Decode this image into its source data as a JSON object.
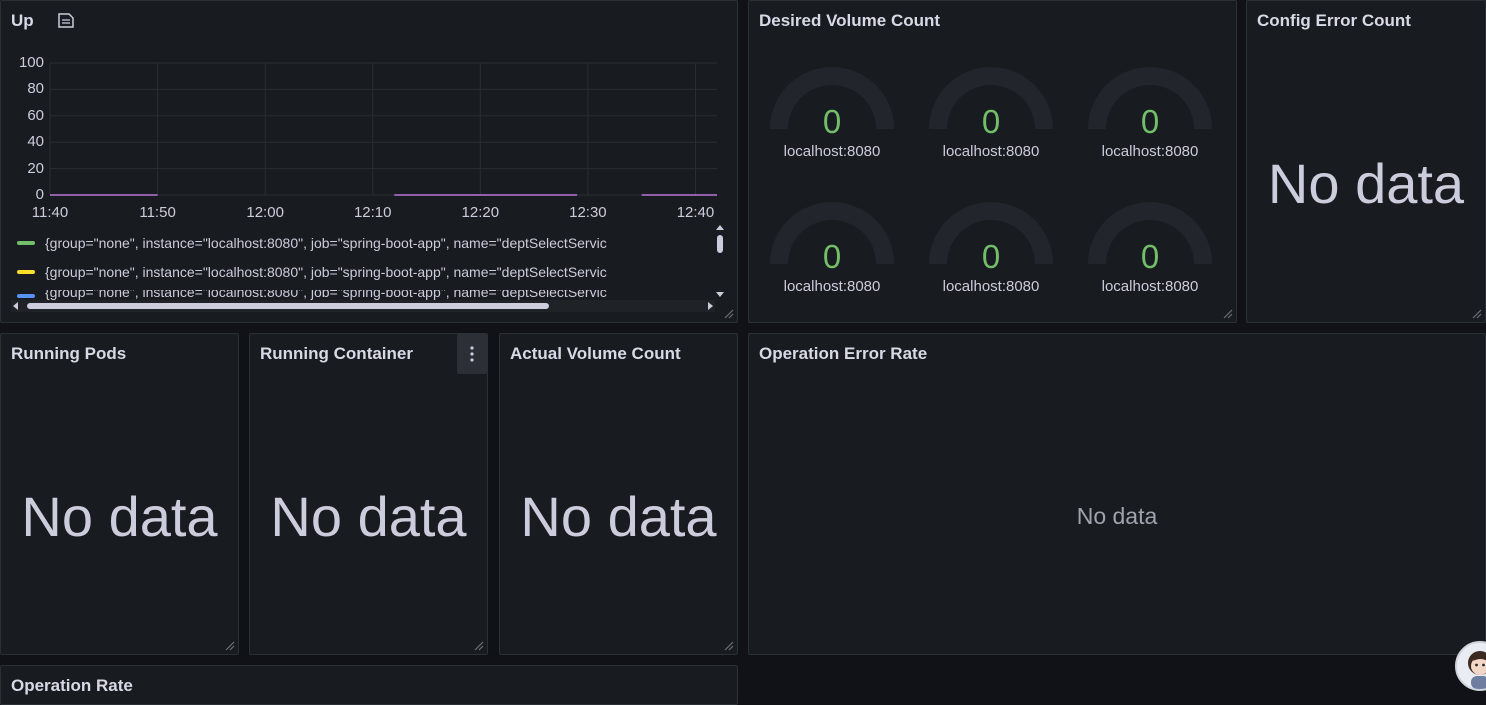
{
  "panels": {
    "up": {
      "title": "Up",
      "legend": [
        {
          "label": "{group=\"none\", instance=\"localhost:8080\", job=\"spring-boot-app\", name=\"deptSelectServic",
          "color": "#73bf69"
        },
        {
          "label": "{group=\"none\", instance=\"localhost:8080\", job=\"spring-boot-app\", name=\"deptSelectServic",
          "color": "#fade2a"
        },
        {
          "label": "{group=\"none\", instance=\"localhost:8080\", job=\"spring-boot-app\", name=\"deptSelectServic",
          "color": "#5794f2"
        }
      ]
    },
    "desired_volume": {
      "title": "Desired Volume Count",
      "gauges": [
        {
          "value": "0",
          "label": "localhost:8080"
        },
        {
          "value": "0",
          "label": "localhost:8080"
        },
        {
          "value": "0",
          "label": "localhost:8080"
        },
        {
          "value": "0",
          "label": "localhost:8080"
        },
        {
          "value": "0",
          "label": "localhost:8080"
        },
        {
          "value": "0",
          "label": "localhost:8080"
        }
      ],
      "value_color": "#73bf69"
    },
    "config_error": {
      "title": "Config Error Count",
      "message": "No data"
    },
    "running_pods": {
      "title": "Running Pods",
      "message": "No data"
    },
    "running_container": {
      "title": "Running Container",
      "message": "No data"
    },
    "actual_volume": {
      "title": "Actual Volume Count",
      "message": "No data"
    },
    "operation_error_rate": {
      "title": "Operation Error Rate",
      "message": "No data"
    },
    "operation_rate": {
      "title": "Operation Rate"
    }
  },
  "chart_data": {
    "type": "line",
    "x": [
      "11:40",
      "11:50",
      "12:00",
      "12:10",
      "12:20",
      "12:30",
      "12:40"
    ],
    "yticks": [
      0,
      20,
      40,
      60,
      80,
      100
    ],
    "ylim": [
      0,
      100
    ],
    "xlim_minutes": [
      0,
      62
    ],
    "grid": true,
    "series": [
      {
        "color": "#b877d9",
        "segments": [
          [
            0,
            10
          ],
          [
            32,
            49
          ],
          [
            55,
            62
          ]
        ],
        "value": 0
      }
    ]
  },
  "colors": {
    "background": "#111217",
    "panel": "#181b1f",
    "border": "#2b2f36",
    "ok": "#73bf69"
  }
}
